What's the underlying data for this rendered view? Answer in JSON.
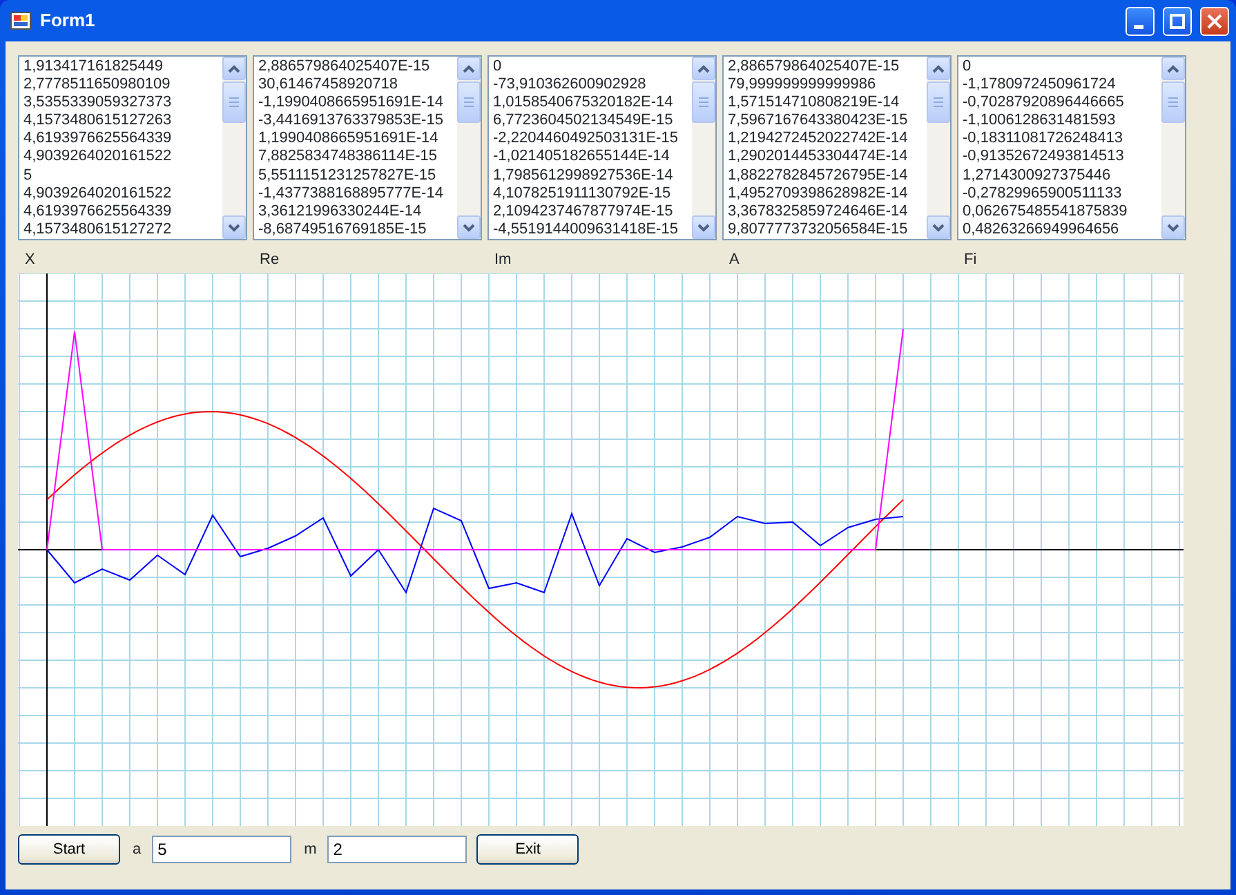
{
  "window": {
    "title": "Form1"
  },
  "lists": [
    {
      "label": "X",
      "items": [
        "1,913417161825449",
        "2,7778511650980109",
        "3,5355339059327373",
        "4,1573480615127263",
        "4,6193976625564339",
        "4,9039264020161522",
        "5",
        "4,9039264020161522",
        "4,6193976625564339",
        "4,1573480615127272"
      ]
    },
    {
      "label": "Re",
      "items": [
        "2,886579864025407E-15",
        "30,61467458920718",
        "-1,1990408665951691E-14",
        "-3,4416913763379853E-15",
        "1,1990408665951691E-14",
        "7,8825834748386114E-15",
        "5,5511151231257827E-15",
        "-1,4377388168895777E-14",
        "3,36121996330244E-14",
        "-8,68749516769185E-15"
      ]
    },
    {
      "label": "Im",
      "items": [
        "0",
        "-73,910362600902928",
        "1,0158540675320182E-14",
        "6,7723604502134549E-15",
        "-2,2204460492503131E-15",
        "-1,021405182655144E-14",
        "1,7985612998927536E-14",
        "4,1078251911130792E-15",
        "2,1094237467877974E-15",
        "-4,5519144009631418E-15"
      ]
    },
    {
      "label": "A",
      "items": [
        "2,886579864025407E-15",
        "79,999999999999986",
        "1,571514710808219E-14",
        "7,5967167643380423E-15",
        "1,2194272452022742E-14",
        "1,2902014453304474E-14",
        "1,8822782845726795E-14",
        "1,4952709398628982E-14",
        "3,3678325859724646E-14",
        "9,8077773732056584E-15"
      ]
    },
    {
      "label": "Fi",
      "items": [
        "0",
        "-1,1780972450961724",
        "-0,70287920896446665",
        "-1,1006128631481593",
        "-0,18311081726248413",
        "-0,91352672493814513",
        "1,2714300927375446",
        "-0,27829965900511133",
        "0,062675485541875839",
        "0,48263266949964656"
      ]
    }
  ],
  "controls": [
    {
      "kind": "button",
      "label": "Start"
    },
    {
      "kind": "field",
      "label": "a",
      "value": "5"
    },
    {
      "kind": "field",
      "label": "m",
      "value": "2"
    },
    {
      "kind": "button",
      "label": "Exit"
    }
  ]
}
